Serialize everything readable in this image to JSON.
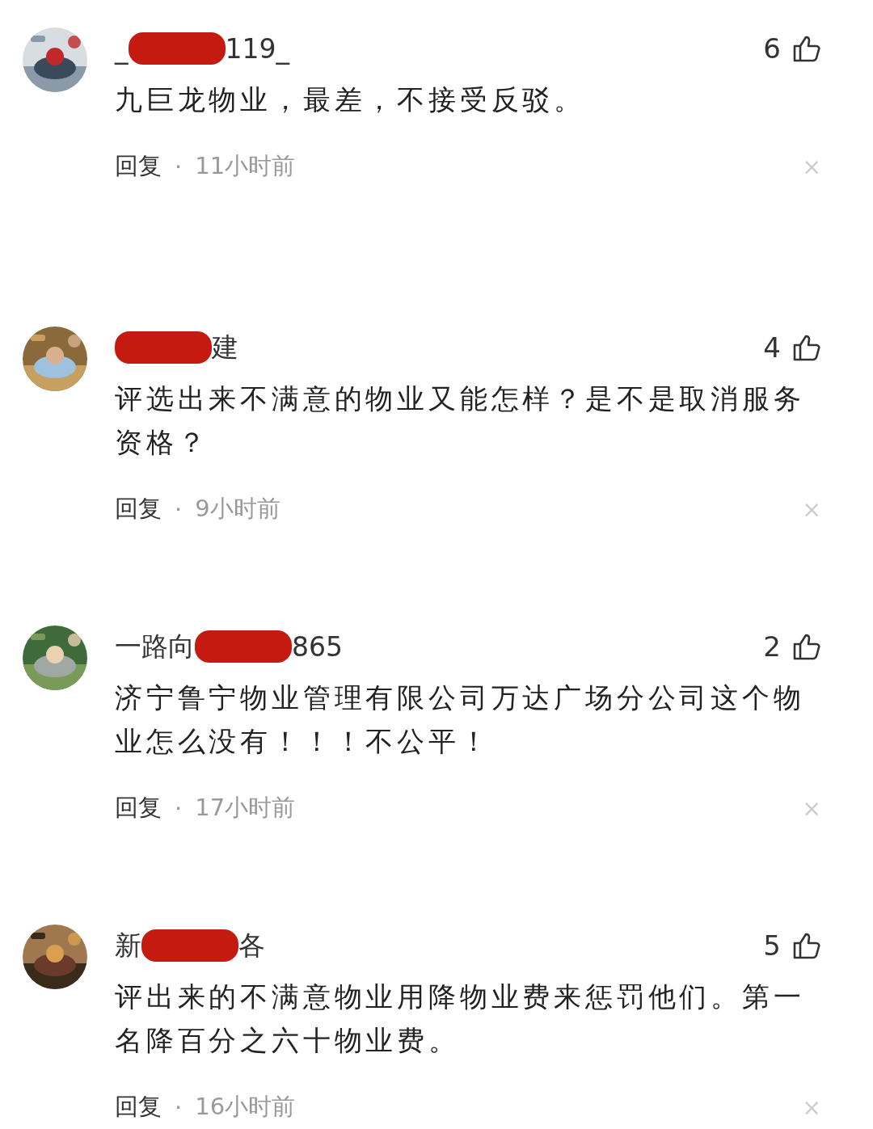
{
  "comments": [
    {
      "name_before": "_",
      "name_after": "119_",
      "likes": "6",
      "text": "九巨龙物业，最差，不接受反驳。",
      "reply": "回复",
      "sep": "·",
      "time": "11小时前",
      "close": "×"
    },
    {
      "name_after": "建",
      "likes": "4",
      "text": "评选出来不满意的物业又能怎样？是不是取消服务资格？",
      "reply": "回复",
      "sep": "·",
      "time": "9小时前",
      "close": "×"
    },
    {
      "name_before": "一路向",
      "name_after": "865",
      "likes": "2",
      "text": "济宁鲁宁物业管理有限公司万达广场分公司这个物业怎么没有！！！不公平！",
      "reply": "回复",
      "sep": "·",
      "time": "17小时前",
      "close": "×"
    },
    {
      "name_before": "新",
      "name_after": "各",
      "likes": "5",
      "text": "评出来的不满意物业用降物业费来惩罚他们。第一名降百分之六十物业费。",
      "reply": "回复",
      "sep": "·",
      "time": "16小时前",
      "close": "×"
    }
  ]
}
